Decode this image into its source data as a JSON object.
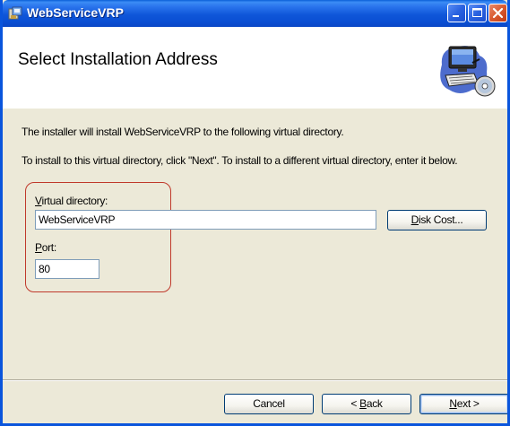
{
  "window": {
    "title": "WebServiceVRP"
  },
  "header": {
    "title": "Select Installation Address"
  },
  "body": {
    "line1": "The installer will install WebServiceVRP to the following virtual directory.",
    "line2": "To install to this virtual directory, click \"Next\". To install to a different virtual directory, enter it below."
  },
  "fields": {
    "virtual_directory": {
      "label_first": "V",
      "label_rest": "irtual directory:",
      "value": "WebServiceVRP"
    },
    "port": {
      "label_first": "P",
      "label_rest": "ort:",
      "value": "80"
    }
  },
  "buttons": {
    "disk_cost": {
      "accel": "D",
      "rest": "isk Cost..."
    },
    "cancel": "Cancel",
    "back": {
      "prefix": "< ",
      "accel": "B",
      "rest": "ack"
    },
    "next": {
      "accel": "N",
      "rest": "ext >"
    }
  },
  "colors": {
    "title_bar": "#0a4fd3",
    "close_button": "#d95a30",
    "highlight_ring": "#c0392b",
    "dialog_bg": "#ece9d8"
  },
  "icons": [
    "installer-icon",
    "minimize-icon",
    "maximize-icon",
    "close-icon",
    "computer-cd-icon"
  ]
}
